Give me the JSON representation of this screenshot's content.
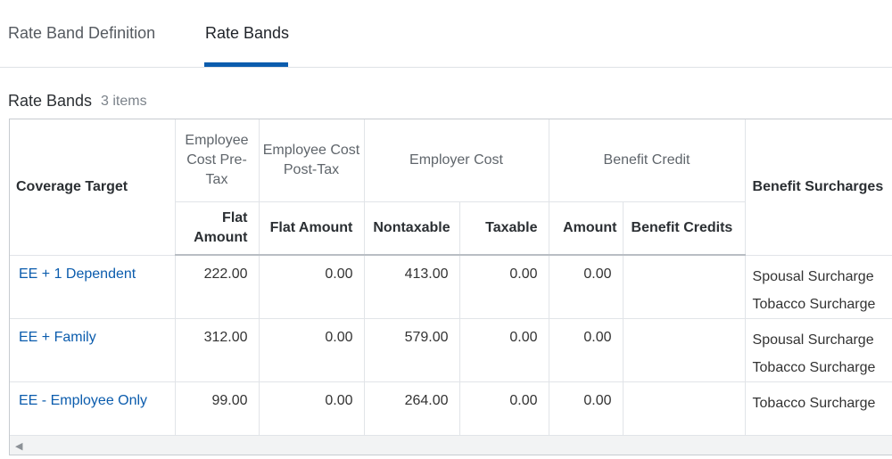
{
  "tabs": {
    "definition": "Rate Band Definition",
    "bands": "Rate Bands"
  },
  "section": {
    "title": "Rate Bands",
    "count": "3 items"
  },
  "table": {
    "headers": {
      "coverage_target": "Coverage Target",
      "emp_pre_tax": "Employee Cost Pre-Tax",
      "emp_post_tax": "Employee Cost Post-Tax",
      "employer_cost": "Employer Cost",
      "benefit_credit": "Benefit Credit",
      "benefit_surcharges": "Benefit Surcharges",
      "flat_amount_pre": "Flat Amount",
      "flat_amount_post": "Flat Amount",
      "nontaxable": "Nontaxable",
      "taxable": "Taxable",
      "amount": "Amount",
      "benefit_credits": "Benefit Credits"
    },
    "rows": [
      {
        "coverage": "EE + 1 Dependent",
        "pre_tax": "222.00",
        "post_tax": "0.00",
        "nontaxable": "413.00",
        "taxable": "0.00",
        "amount": "0.00",
        "benefit_credits": "",
        "surcharges": [
          "Spousal Surcharge",
          "Tobacco Surcharge"
        ]
      },
      {
        "coverage": "EE + Family",
        "pre_tax": "312.00",
        "post_tax": "0.00",
        "nontaxable": "579.00",
        "taxable": "0.00",
        "amount": "0.00",
        "benefit_credits": "",
        "surcharges": [
          "Spousal Surcharge",
          "Tobacco Surcharge"
        ]
      },
      {
        "coverage": "EE - Employee Only",
        "pre_tax": "99.00",
        "post_tax": "0.00",
        "nontaxable": "264.00",
        "taxable": "0.00",
        "amount": "0.00",
        "benefit_credits": "",
        "surcharges": [
          "Tobacco Surcharge"
        ]
      }
    ]
  },
  "scrollbar": {
    "left_arrow_icon": "chevron-left-icon"
  },
  "colors": {
    "accent": "#0b5cad",
    "link": "#0b5cad"
  }
}
